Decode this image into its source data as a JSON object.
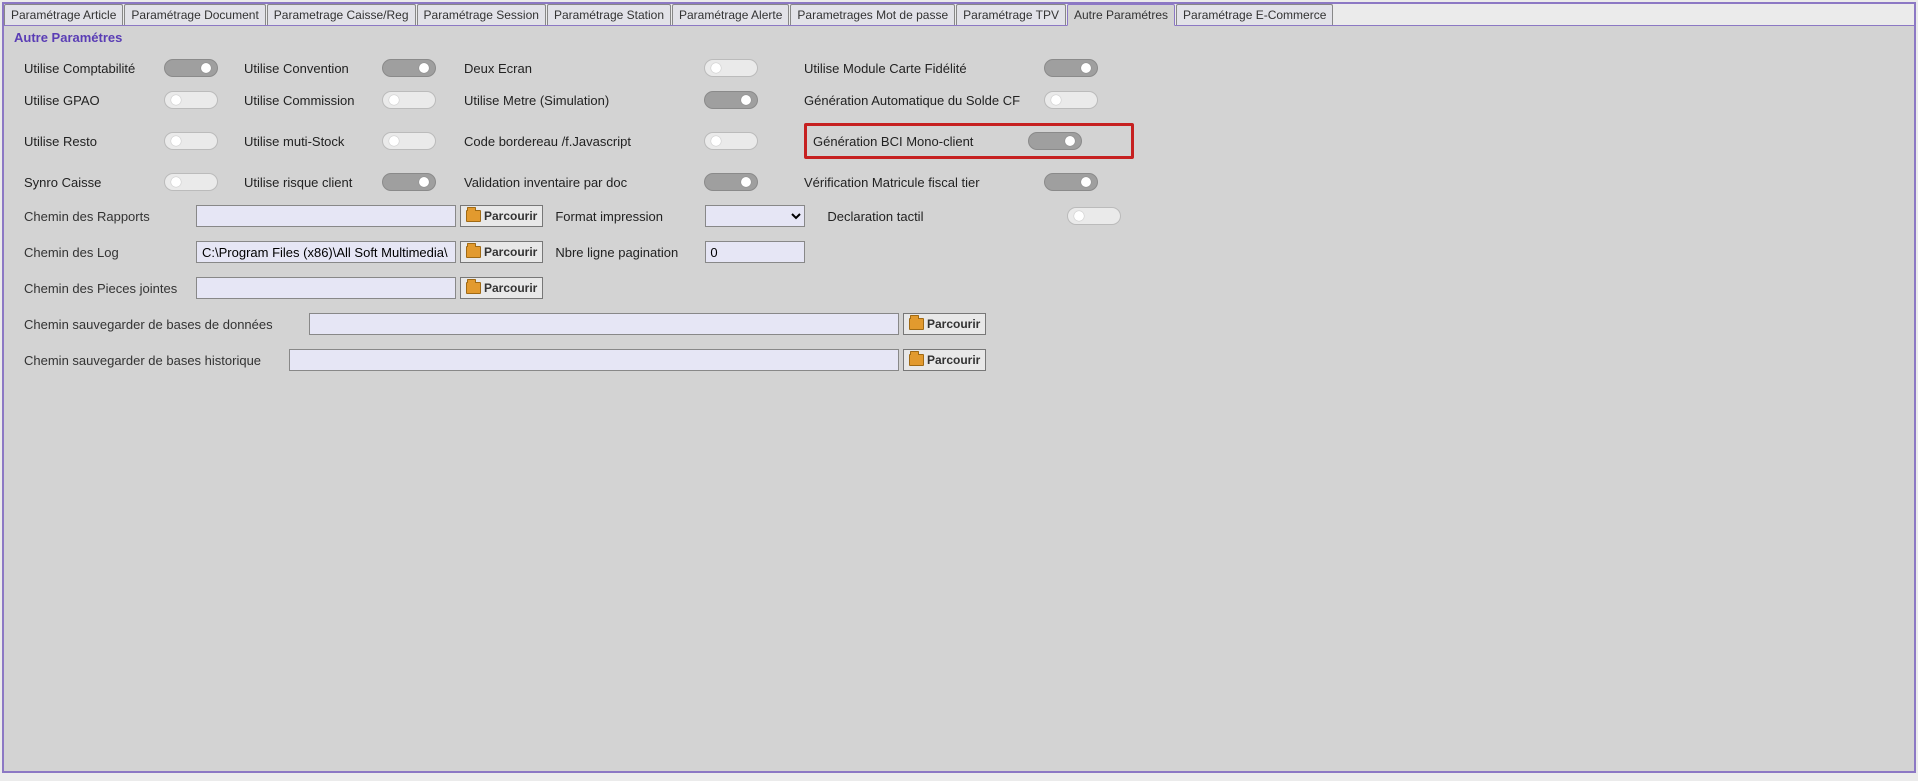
{
  "tabs": [
    "Paramétrage Article",
    "Paramétrage Document",
    "Parametrage Caisse/Reg",
    "Paramétrage Session",
    "Paramétrage Station",
    "Paramétrage Alerte",
    "Parametrages Mot de passe",
    "Paramétrage TPV",
    "Autre Paramétres",
    "Paramétrage E-Commerce"
  ],
  "active_tab_index": 8,
  "section_title": "Autre Paramétres",
  "toggles": {
    "utilise_comptabilite": {
      "label": "Utilise Comptabilité",
      "on": true
    },
    "utilise_gpao": {
      "label": "Utilise GPAO",
      "on": false
    },
    "utilise_resto": {
      "label": "Utilise Resto",
      "on": false
    },
    "synro_caisse": {
      "label": "Synro Caisse",
      "on": false
    },
    "utilise_convention": {
      "label": "Utilise Convention",
      "on": true
    },
    "utilise_commission": {
      "label": "Utilise Commission",
      "on": false
    },
    "utilise_muti_stock": {
      "label": "Utilise muti-Stock",
      "on": false
    },
    "utilise_risque_client": {
      "label": "Utilise risque client",
      "on": true
    },
    "deux_ecran": {
      "label": "Deux Ecran",
      "on": false
    },
    "utilise_metre": {
      "label": "Utilise Metre (Simulation)",
      "on": true
    },
    "code_bordereau": {
      "label": "Code bordereau /f.Javascript",
      "on": false
    },
    "validation_inventaire": {
      "label": "Validation inventaire par doc",
      "on": true
    },
    "module_carte_fidelite": {
      "label": "Utilise Module Carte Fidélité",
      "on": true
    },
    "gen_auto_solde_cf": {
      "label": "Génération Automatique du Solde CF",
      "on": false
    },
    "gen_bci_mono_client": {
      "label": "Génération BCI Mono-client",
      "on": true
    },
    "verif_matricule_fiscal": {
      "label": "Vérification Matricule fiscal tier",
      "on": true
    },
    "declaration_tactil": {
      "label": "Declaration tactil",
      "on": false
    }
  },
  "paths": {
    "rapports": {
      "label": "Chemin des Rapports",
      "value": ""
    },
    "log": {
      "label": "Chemin des Log",
      "value": "C:\\Program Files (x86)\\All Soft Multimedia\\"
    },
    "pieces_jointes": {
      "label": "Chemin des Pieces jointes",
      "value": ""
    },
    "sauvegarde_bdd": {
      "label": "Chemin sauvegarder de bases de données",
      "value": ""
    },
    "sauvegarde_historique": {
      "label": "Chemin sauvegarder de bases historique",
      "value": ""
    }
  },
  "format_impression": {
    "label": "Format impression",
    "value": ""
  },
  "nbre_ligne_pagination": {
    "label": "Nbre ligne pagination",
    "value": "0"
  },
  "browse_label": "Parcourir"
}
